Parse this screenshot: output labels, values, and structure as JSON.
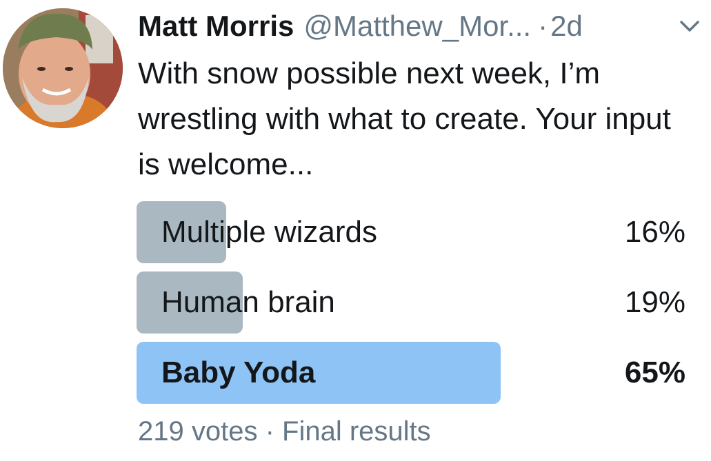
{
  "tweet": {
    "author_name": "Matt Morris",
    "handle": "@Matthew_Mor...",
    "separator": "·",
    "time": "2d",
    "text": "With snow possible next week, I’m wrestling with what to create. Your input is welcome..."
  },
  "poll": {
    "options": [
      {
        "label": "Multiple wizards",
        "percent_text": "16%",
        "percent": 16,
        "winner": false
      },
      {
        "label": "Human brain",
        "percent_text": "19%",
        "percent": 19,
        "winner": false
      },
      {
        "label": "Baby Yoda",
        "percent_text": "65%",
        "percent": 65,
        "winner": true
      }
    ],
    "votes": "219 votes",
    "meta_separator": "·",
    "status": "Final results"
  },
  "icons": {
    "menu": "chevron-down-icon",
    "avatar": "avatar"
  },
  "colors": {
    "bar": "#aab8c2",
    "winner_bar": "#8ec3f5",
    "muted_text": "#657786"
  }
}
